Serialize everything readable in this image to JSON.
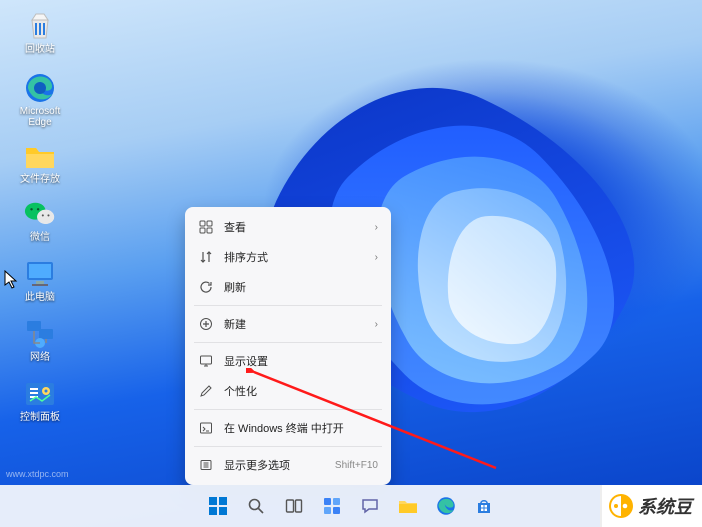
{
  "desktop_icons": {
    "recycle_bin": "回收站",
    "edge": "Microsoft Edge",
    "folder": "文件存放",
    "wechat": "微信",
    "this_pc": "此电脑",
    "network": "网络",
    "control_panel": "控制面板"
  },
  "context_menu": {
    "view": "查看",
    "sort": "排序方式",
    "refresh": "刷新",
    "new": "新建",
    "display_settings": "显示设置",
    "personalize": "个性化",
    "open_terminal": "在 Windows 终端 中打开",
    "more_options": "显示更多选项",
    "more_options_shortcut": "Shift+F10"
  },
  "watermark": {
    "site": "www.xtdpc.com",
    "brand": "系统豆"
  }
}
